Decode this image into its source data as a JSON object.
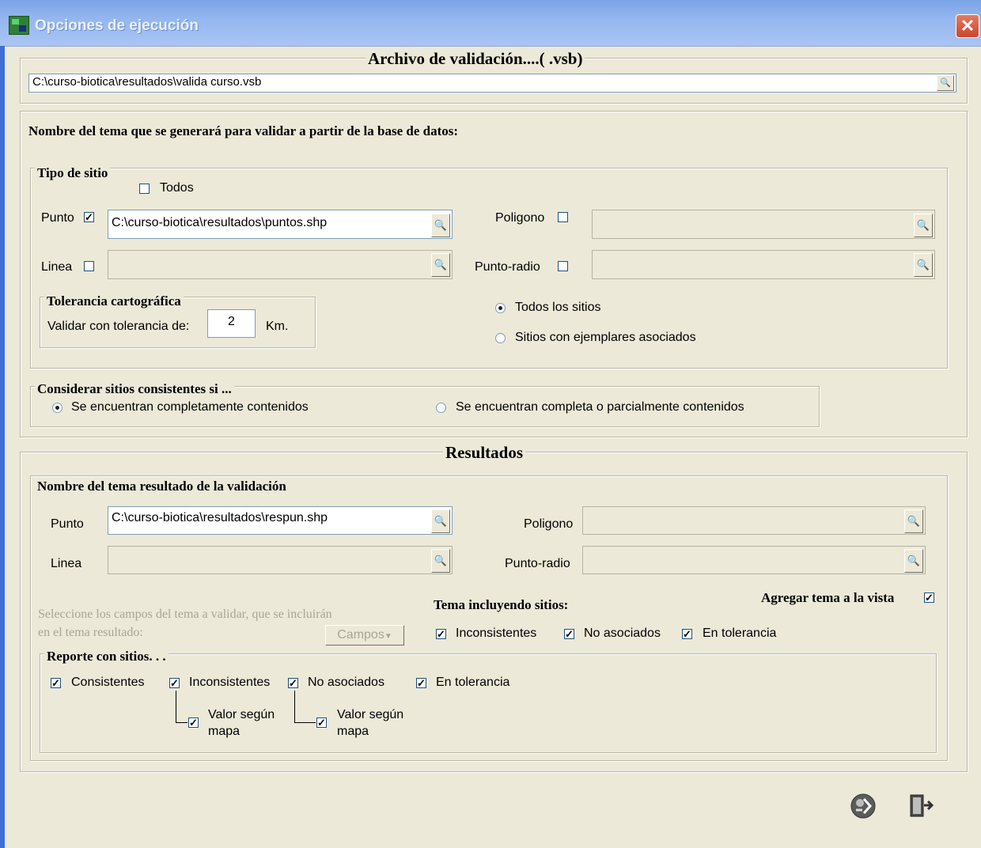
{
  "window": {
    "title": "Opciones de ejecución",
    "close_icon": "close-icon"
  },
  "archivo": {
    "legend": "Archivo de validación....( .vsb)",
    "path": "C:\\curso-biotica\\resultados\\valida  curso.vsb"
  },
  "nombre_tema_heading": "Nombre del tema que se generará para validar a partir de la base de datos:",
  "tipo_sitio": {
    "legend": "Tipo de sitio",
    "todos_label": "Todos",
    "todos_checked": false,
    "punto_label": "Punto",
    "punto_checked": true,
    "punto_path": "C:\\curso-biotica\\resultados\\puntos.shp",
    "linea_label": "Linea",
    "linea_checked": false,
    "linea_path": "",
    "poligono_label": "Poligono",
    "poligono_checked": false,
    "poligono_path": "",
    "puntoradio_label": "Punto-radio",
    "puntoradio_checked": false,
    "puntoradio_path": ""
  },
  "tolerancia": {
    "legend": "Tolerancia cartográfica",
    "label": "Validar con tolerancia de:",
    "value": "2",
    "unit": "Km."
  },
  "sitios_radio": {
    "todos": "Todos los sitios",
    "ejemplares": "Sitios con ejemplares asociados",
    "selected": "todos"
  },
  "consistentes": {
    "legend": "Considerar sitios consistentes si ...",
    "completos": "Se encuentran completamente contenidos",
    "parcial": "Se encuentran completa o parcialmente contenidos",
    "selected": "completos"
  },
  "resultados": {
    "legend": "Resultados",
    "nombre_legend": "Nombre del tema resultado de la validación",
    "punto_label": "Punto",
    "punto_path": "C:\\curso-biotica\\resultados\\respun.shp",
    "linea_label": "Linea",
    "linea_path": "",
    "poligono_label": "Poligono",
    "poligono_path": "",
    "puntoradio_label": "Punto-radio",
    "puntoradio_path": "",
    "campos_text_1": "Seleccione los campos del tema a validar, que se incluirán",
    "campos_text_2": "en el tema resultado:",
    "campos_button": "Campos",
    "agregar_label": "Agregar tema a la vista",
    "agregar_checked": true,
    "tema_incluyendo_label": "Tema incluyendo sitios:",
    "inconsistentes": "Inconsistentes",
    "no_asociados": "No asociados",
    "en_tolerancia": "En tolerancia"
  },
  "reporte": {
    "legend": "Reporte con sitios. . .",
    "consistentes": "Consistentes",
    "inconsistentes": "Inconsistentes",
    "no_asociados": "No asociados",
    "en_tolerancia": "En tolerancia",
    "valor_1": "Valor según",
    "valor_2": "mapa"
  },
  "actions": {
    "run_icon": "run-icon",
    "exit_icon": "exit-door-icon"
  },
  "colors": {
    "titlebar": "#7aa4e6",
    "background": "#ece9d8",
    "close": "#c9462b"
  }
}
